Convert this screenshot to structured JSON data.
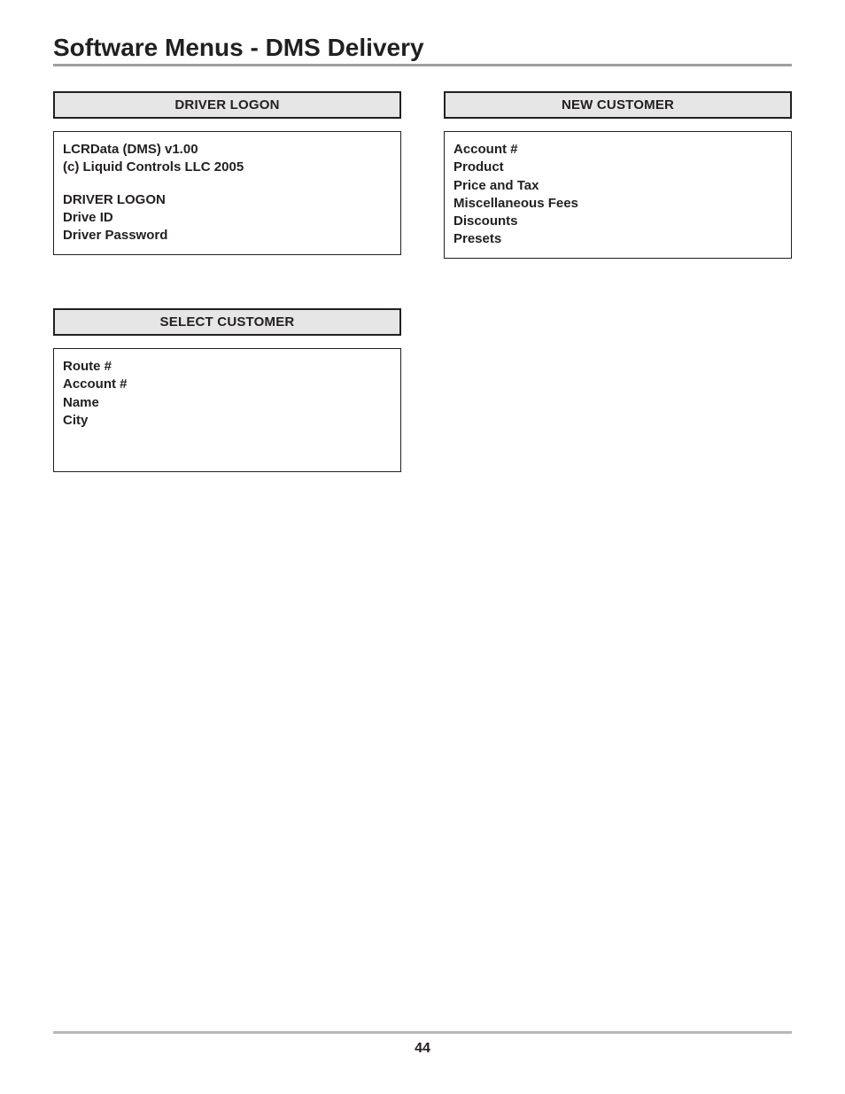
{
  "page": {
    "title": "Software Menus - DMS Delivery",
    "number": "44"
  },
  "left": {
    "driver_logon": {
      "header": "DRIVER LOGON",
      "line1": "LCRData (DMS) v1.00",
      "line2": "(c) Liquid Controls LLC 2005",
      "line3": "DRIVER LOGON",
      "line4": "Drive ID",
      "line5": "Driver Password"
    },
    "select_customer": {
      "header": "SELECT CUSTOMER",
      "line1": "Route #",
      "line2": "Account #",
      "line3": "Name",
      "line4": "City"
    }
  },
  "right": {
    "new_customer": {
      "header": "NEW CUSTOMER",
      "line1": "Account #",
      "line2": "Product",
      "line3": "Price and Tax",
      "line4": "Miscellaneous Fees",
      "line5": "Discounts",
      "line6": "Presets"
    }
  }
}
